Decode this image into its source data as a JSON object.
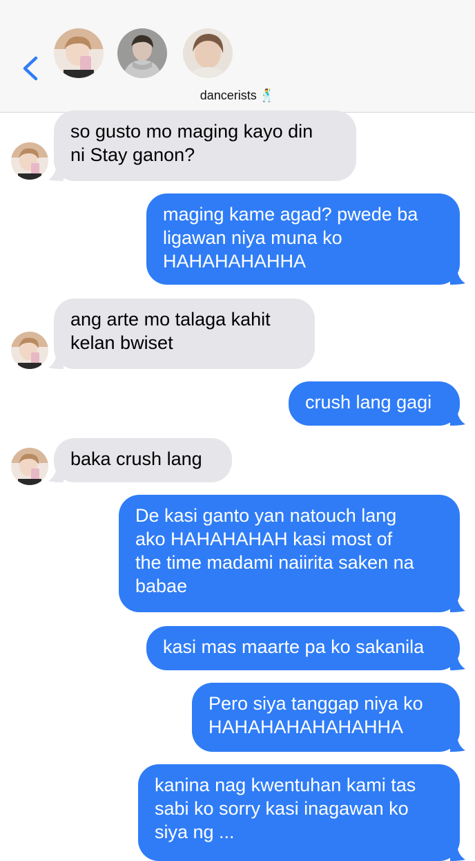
{
  "header": {
    "group_name": "dancerists",
    "group_emoji": "🕺",
    "back_icon": "chevron-left-icon",
    "avatars": [
      "avatar-1",
      "avatar-2",
      "avatar-3"
    ]
  },
  "colors": {
    "incoming_bubble": "#e5e5ea",
    "outgoing_bubble": "#2f7cf6",
    "accent": "#2f7cf6"
  },
  "messages": [
    {
      "dir": "in",
      "lines": [
        "so gusto mo maging kayo din",
        "ni Stay ganon?"
      ]
    },
    {
      "dir": "out",
      "lines": [
        "maging kame agad? pwede ba",
        "ligawan niya muna ko",
        "HAHAHAHAHHA"
      ]
    },
    {
      "dir": "in",
      "lines": [
        "ang arte mo talaga kahit",
        "kelan bwiset"
      ]
    },
    {
      "dir": "out",
      "lines": [
        "crush lang gagi"
      ]
    },
    {
      "dir": "in",
      "lines": [
        "baka crush lang"
      ]
    },
    {
      "dir": "out",
      "lines": [
        "De kasi ganto yan natouch lang",
        "ako HAHAHAHAH kasi most of",
        "the time madami naiirita saken na",
        "babae"
      ]
    },
    {
      "dir": "out",
      "lines": [
        "kasi mas maarte pa ko sakanila"
      ]
    },
    {
      "dir": "out",
      "lines": [
        "Pero siya tanggap niya ko",
        "HAHAHAHAHAHAHHA"
      ]
    },
    {
      "dir": "out",
      "lines": [
        "kanina nag kwentuhan kami tas",
        "sabi ko sorry kasi inagawan ko",
        "siya ng ..."
      ]
    }
  ]
}
